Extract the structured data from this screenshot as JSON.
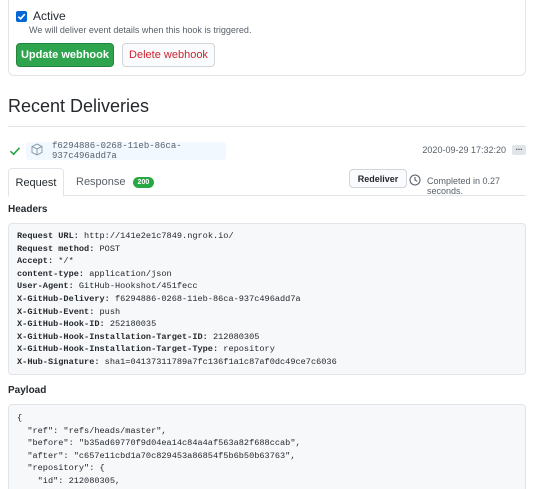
{
  "webhook_form": {
    "active_label": "Active",
    "active_checked": true,
    "active_note": "We will deliver event details when this hook is triggered.",
    "update_button": "Update webhook",
    "delete_button": "Delete webhook"
  },
  "recent_deliveries": {
    "title": "Recent Deliveries",
    "delivery": {
      "guid": "f6294886-0268-11eb-86ca-937c496add7a",
      "timestamp": "2020-09-29 17:32:20",
      "more_label": "..."
    },
    "tabs": {
      "request": "Request",
      "response": "Response",
      "response_badge": "200"
    },
    "redeliver_button": "Redeliver",
    "completed_text": "Completed in 0.27 seconds.",
    "headers_title": "Headers",
    "headers": [
      {
        "key": "Request URL:",
        "value": "http://141e2e1c7849.ngrok.io/"
      },
      {
        "key": "Request method:",
        "value": "POST"
      },
      {
        "key": "Accept:",
        "value": "*/*"
      },
      {
        "key": "content-type:",
        "value": "application/json"
      },
      {
        "key": "User-Agent:",
        "value": "GitHub-Hookshot/451fecc"
      },
      {
        "key": "X-GitHub-Delivery:",
        "value": "f6294886-0268-11eb-86ca-937c496add7a"
      },
      {
        "key": "X-GitHub-Event:",
        "value": "push"
      },
      {
        "key": "X-GitHub-Hook-ID:",
        "value": "252180035"
      },
      {
        "key": "X-GitHub-Hook-Installation-Target-ID:",
        "value": "212080305"
      },
      {
        "key": "X-GitHub-Hook-Installation-Target-Type:",
        "value": "repository"
      },
      {
        "key": "X-Hub-Signature:",
        "value": "sha1=04137311789a7fc136f1a1c87af0dc49ce7c6036"
      }
    ],
    "payload_title": "Payload",
    "payload_lines": [
      "{",
      "  \"ref\": \"refs/heads/master\",",
      "  \"before\": \"b35ad69770f9d04ea14c84a4af563a82f688ccab\",",
      "  \"after\": \"c657e11cbd1a70c829453a86854f5b6b50b63763\",",
      "  \"repository\": {",
      "    \"id\": 212080305,"
    ]
  },
  "colors": {
    "primary_green": "#2ea44f",
    "danger_red": "#cb2431",
    "checkbox_blue": "#0366d6",
    "success_check": "#28a745"
  }
}
